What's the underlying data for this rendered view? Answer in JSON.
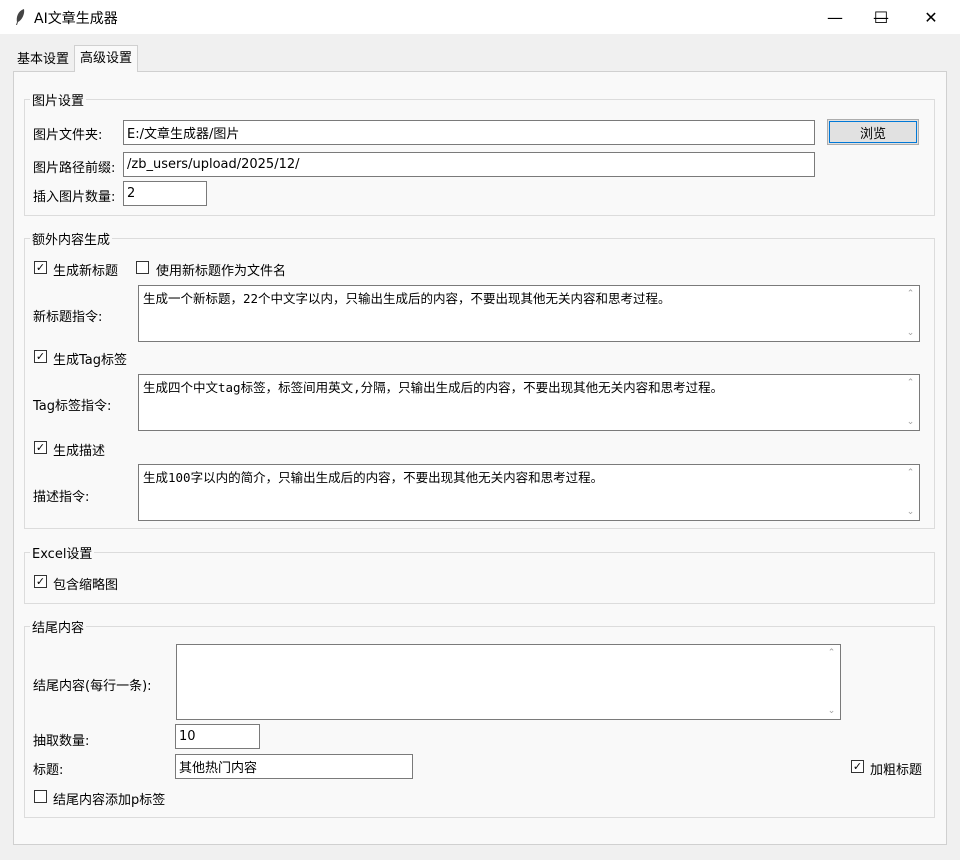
{
  "window": {
    "title": "AI文章生成器",
    "icon": "feather-icon",
    "minimize_glyph": "—",
    "maximize_glyph": "☐",
    "close_glyph": "✕"
  },
  "tabs": [
    {
      "label": "基本设置",
      "active": false
    },
    {
      "label": "高级设置",
      "active": true
    }
  ],
  "image_settings": {
    "title": "图片设置",
    "folder_label": "图片文件夹:",
    "folder_value": "E:/文章生成器/图片",
    "browse_label": "浏览",
    "prefix_label": "图片路径前缀:",
    "prefix_value": "/zb_users/upload/2025/12/",
    "count_label": "插入图片数量:",
    "count_value": "2"
  },
  "extra_content": {
    "title": "额外内容生成",
    "gen_title_label": "生成新标题",
    "gen_title_checked": true,
    "use_title_filename_label": "使用新标题作为文件名",
    "use_title_filename_checked": false,
    "title_prompt_label": "新标题指令:",
    "title_prompt_value": "生成一个新标题，22个中文字以内，只输出生成后的内容，不要出现其他无关内容和思考过程。",
    "gen_tag_label": "生成Tag标签",
    "gen_tag_checked": true,
    "tag_prompt_label": "Tag标签指令:",
    "tag_prompt_value": "生成四个中文tag标签，标签间用英文,分隔，只输出生成后的内容，不要出现其他无关内容和思考过程。",
    "gen_desc_label": "生成描述",
    "gen_desc_checked": true,
    "desc_prompt_label": "描述指令:",
    "desc_prompt_value": "生成100字以内的简介，只输出生成后的内容，不要出现其他无关内容和思考过程。"
  },
  "excel_settings": {
    "title": "Excel设置",
    "thumbnail_label": "包含缩略图",
    "thumbnail_checked": true
  },
  "ending": {
    "title": "结尾内容",
    "content_label": "结尾内容(每行一条):",
    "content_value": "",
    "pick_count_label": "抽取数量:",
    "pick_count_value": "10",
    "heading_label": "标题:",
    "heading_value": "其他热门内容",
    "bold_label": "加粗标题",
    "bold_checked": true,
    "p_tag_label": "结尾内容添加p标签",
    "p_tag_checked": false
  },
  "scroll_glyphs": {
    "up": "⌃",
    "down": "⌄"
  }
}
